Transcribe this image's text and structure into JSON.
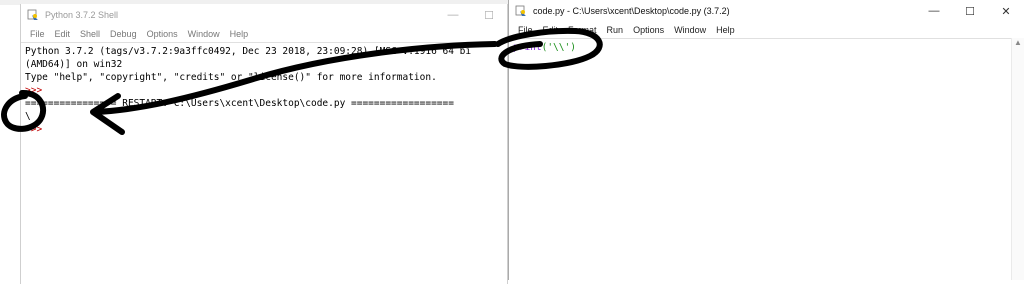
{
  "shell": {
    "title": "Python 3.7.2 Shell",
    "menu": [
      "File",
      "Edit",
      "Shell",
      "Debug",
      "Options",
      "Window",
      "Help"
    ],
    "lines": [
      "Python 3.7.2 (tags/v3.7.2:9a3ffc0492, Dec 23 2018, 23:09:28) [MSC v.1916 64 bi",
      "(AMD64)] on win32",
      "Type \"help\", \"copyright\", \"credits\" or \"license()\" for more information.",
      ">>> ",
      "================ RESTART: C:\\Users\\xcent\\Desktop\\code.py ==================",
      "\\",
      ">>> "
    ]
  },
  "editor": {
    "title": "code.py - C:\\Users\\xcent\\Desktop\\code.py (3.7.2)",
    "menu": [
      "File",
      "Edit",
      "Format",
      "Run",
      "Options",
      "Window",
      "Help"
    ],
    "code_keyword": "print",
    "code_rest": "('\\\\')"
  },
  "controls": {
    "minimize": "—",
    "maximize": "☐",
    "close": "✕"
  },
  "colors": {
    "prompt": "#c00000",
    "keyword": "#8a2be2",
    "string": "#1a8f1a",
    "annotation": "#000000"
  }
}
